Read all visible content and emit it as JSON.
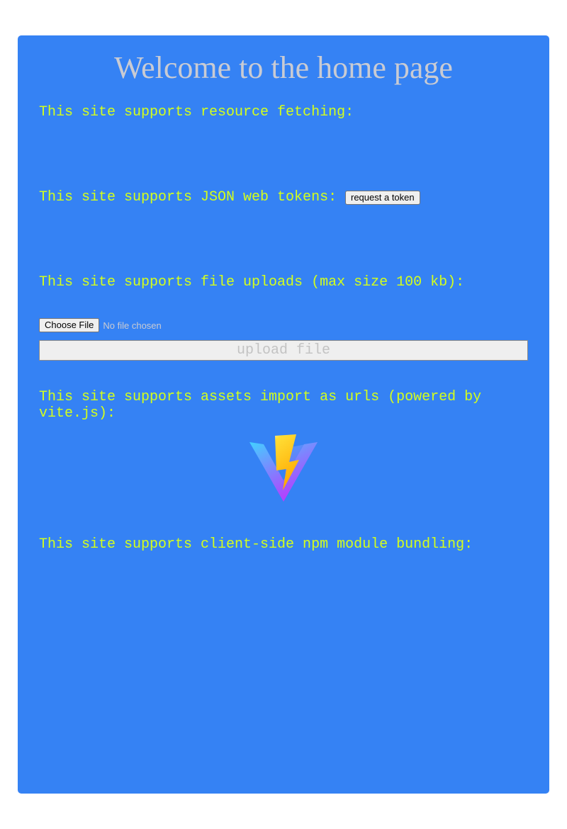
{
  "page": {
    "title": "Welcome to the home page"
  },
  "sections": {
    "resource_fetching": {
      "label": "This site supports resource fetching:"
    },
    "jwt": {
      "label": "This site supports JSON web tokens:",
      "button_label": "request a token"
    },
    "file_uploads": {
      "label": "This site supports file uploads (max size 100 kb):",
      "choose_button_label": "Choose File",
      "file_status": "No file chosen",
      "upload_button_label": "upload file"
    },
    "assets": {
      "label": "This site supports assets import as urls (powered by vite.js):",
      "logo_icon": "vite-logo-icon"
    },
    "npm_bundling": {
      "label": "This site supports client-side npm module bundling:"
    }
  },
  "colors": {
    "panel_background": "#3582f4",
    "text_accent": "#d4ff1c",
    "title_text": "#c9cbd3"
  }
}
